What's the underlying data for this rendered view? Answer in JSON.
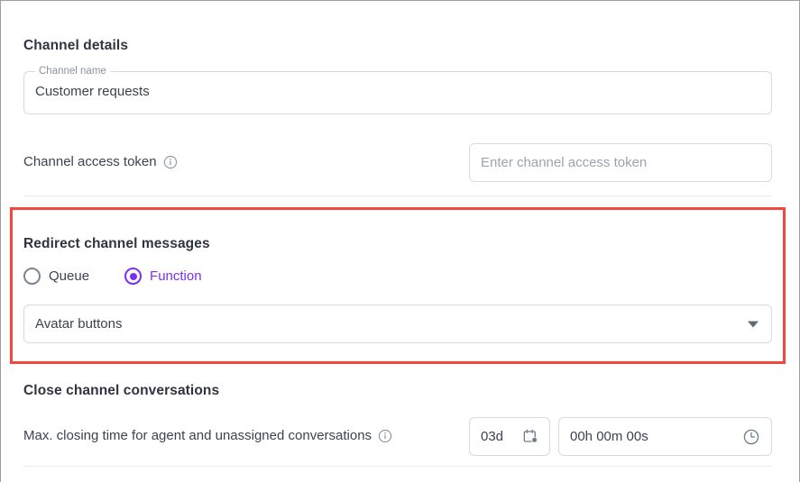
{
  "colors": {
    "accent_purple": "#7b2ff2",
    "highlight_red": "#f4463c",
    "text_primary": "#3c4250",
    "text_muted": "#8b93a1",
    "border": "#d6dae0",
    "icon_gray": "#6b7c8c"
  },
  "sections": {
    "channel_details": {
      "title": "Channel details",
      "channel_name": {
        "legend": "Channel name",
        "value": "Customer requests"
      },
      "access_token": {
        "label": "Channel access token",
        "info_icon": "info-icon",
        "placeholder": "Enter channel access token",
        "value": ""
      }
    },
    "redirect": {
      "title": "Redirect channel messages",
      "options": [
        {
          "label": "Queue",
          "selected": false
        },
        {
          "label": "Function",
          "selected": true
        }
      ],
      "dropdown": {
        "value": "Avatar buttons",
        "arrow_icon": "chevron-down-icon"
      }
    },
    "close_conversations": {
      "title": "Close channel conversations",
      "max_closing_time": {
        "label": "Max. closing time for agent and unassigned conversations",
        "info_icon": "info-icon",
        "days": {
          "value": "03d",
          "icon": "calendar-icon"
        },
        "time": {
          "value": "00h 00m 00s",
          "icon": "clock-icon"
        }
      }
    }
  }
}
